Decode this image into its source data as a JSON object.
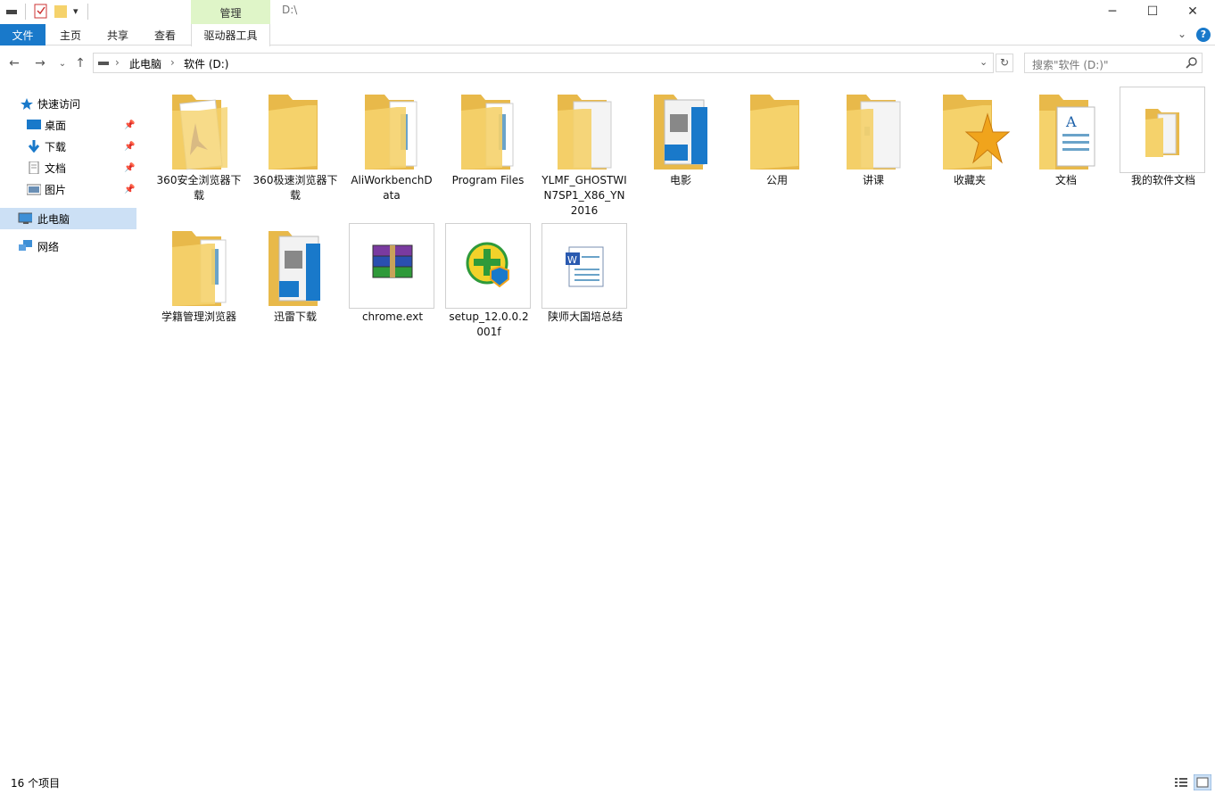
{
  "window": {
    "title": "D:\\",
    "manage_tab": "管理",
    "minimize": "─",
    "maximize": "☐",
    "close": "✕"
  },
  "ribbon": {
    "tabs": [
      "文件",
      "主页",
      "共享",
      "查看",
      "驱动器工具"
    ],
    "help": "?"
  },
  "address": {
    "crumbs": [
      "此电脑",
      "软件 (D:)"
    ],
    "refresh": "↻"
  },
  "search": {
    "placeholder": "搜索\"软件 (D:)\""
  },
  "sidebar": {
    "quick_access": "快速访问",
    "pinned": [
      "桌面",
      "下载",
      "文档",
      "图片"
    ],
    "this_pc": "此电脑",
    "network": "网络"
  },
  "items": [
    {
      "name": "360安全浏览器下载",
      "icon": "folder-icon"
    },
    {
      "name": "360极速浏览器下载",
      "icon": "folder-icon"
    },
    {
      "name": "AliWorkbenchData",
      "icon": "folder-icon"
    },
    {
      "name": "Program Files",
      "icon": "folder-icon"
    },
    {
      "name": "YLMF_GHOSTWIN7SP1_X86_YN2016",
      "icon": "folder-icon"
    },
    {
      "name": "电影",
      "icon": "folder-video-icon"
    },
    {
      "name": "公用",
      "icon": "folder-icon"
    },
    {
      "name": "讲课",
      "icon": "folder-icon"
    },
    {
      "name": "收藏夹",
      "icon": "favorites-folder-icon"
    },
    {
      "name": "文档",
      "icon": "documents-folder-icon"
    },
    {
      "name": "我的软件文档",
      "icon": "folder-icon"
    },
    {
      "name": "学籍管理浏览器",
      "icon": "folder-icon"
    },
    {
      "name": "迅雷下载",
      "icon": "folder-video-icon"
    },
    {
      "name": "chrome.ext",
      "icon": "winrar-archive-icon"
    },
    {
      "name": "setup_12.0.0.2001f",
      "icon": "setup-installer-icon"
    },
    {
      "name": "陕师大国培总结",
      "icon": "word-document-icon"
    }
  ],
  "status": {
    "count": "16 个项目"
  },
  "colors": {
    "file_tab": "#1979ca",
    "manage_tab": "#dff5c8",
    "folder": "#f5d26b",
    "selection": "#cde8ff"
  }
}
